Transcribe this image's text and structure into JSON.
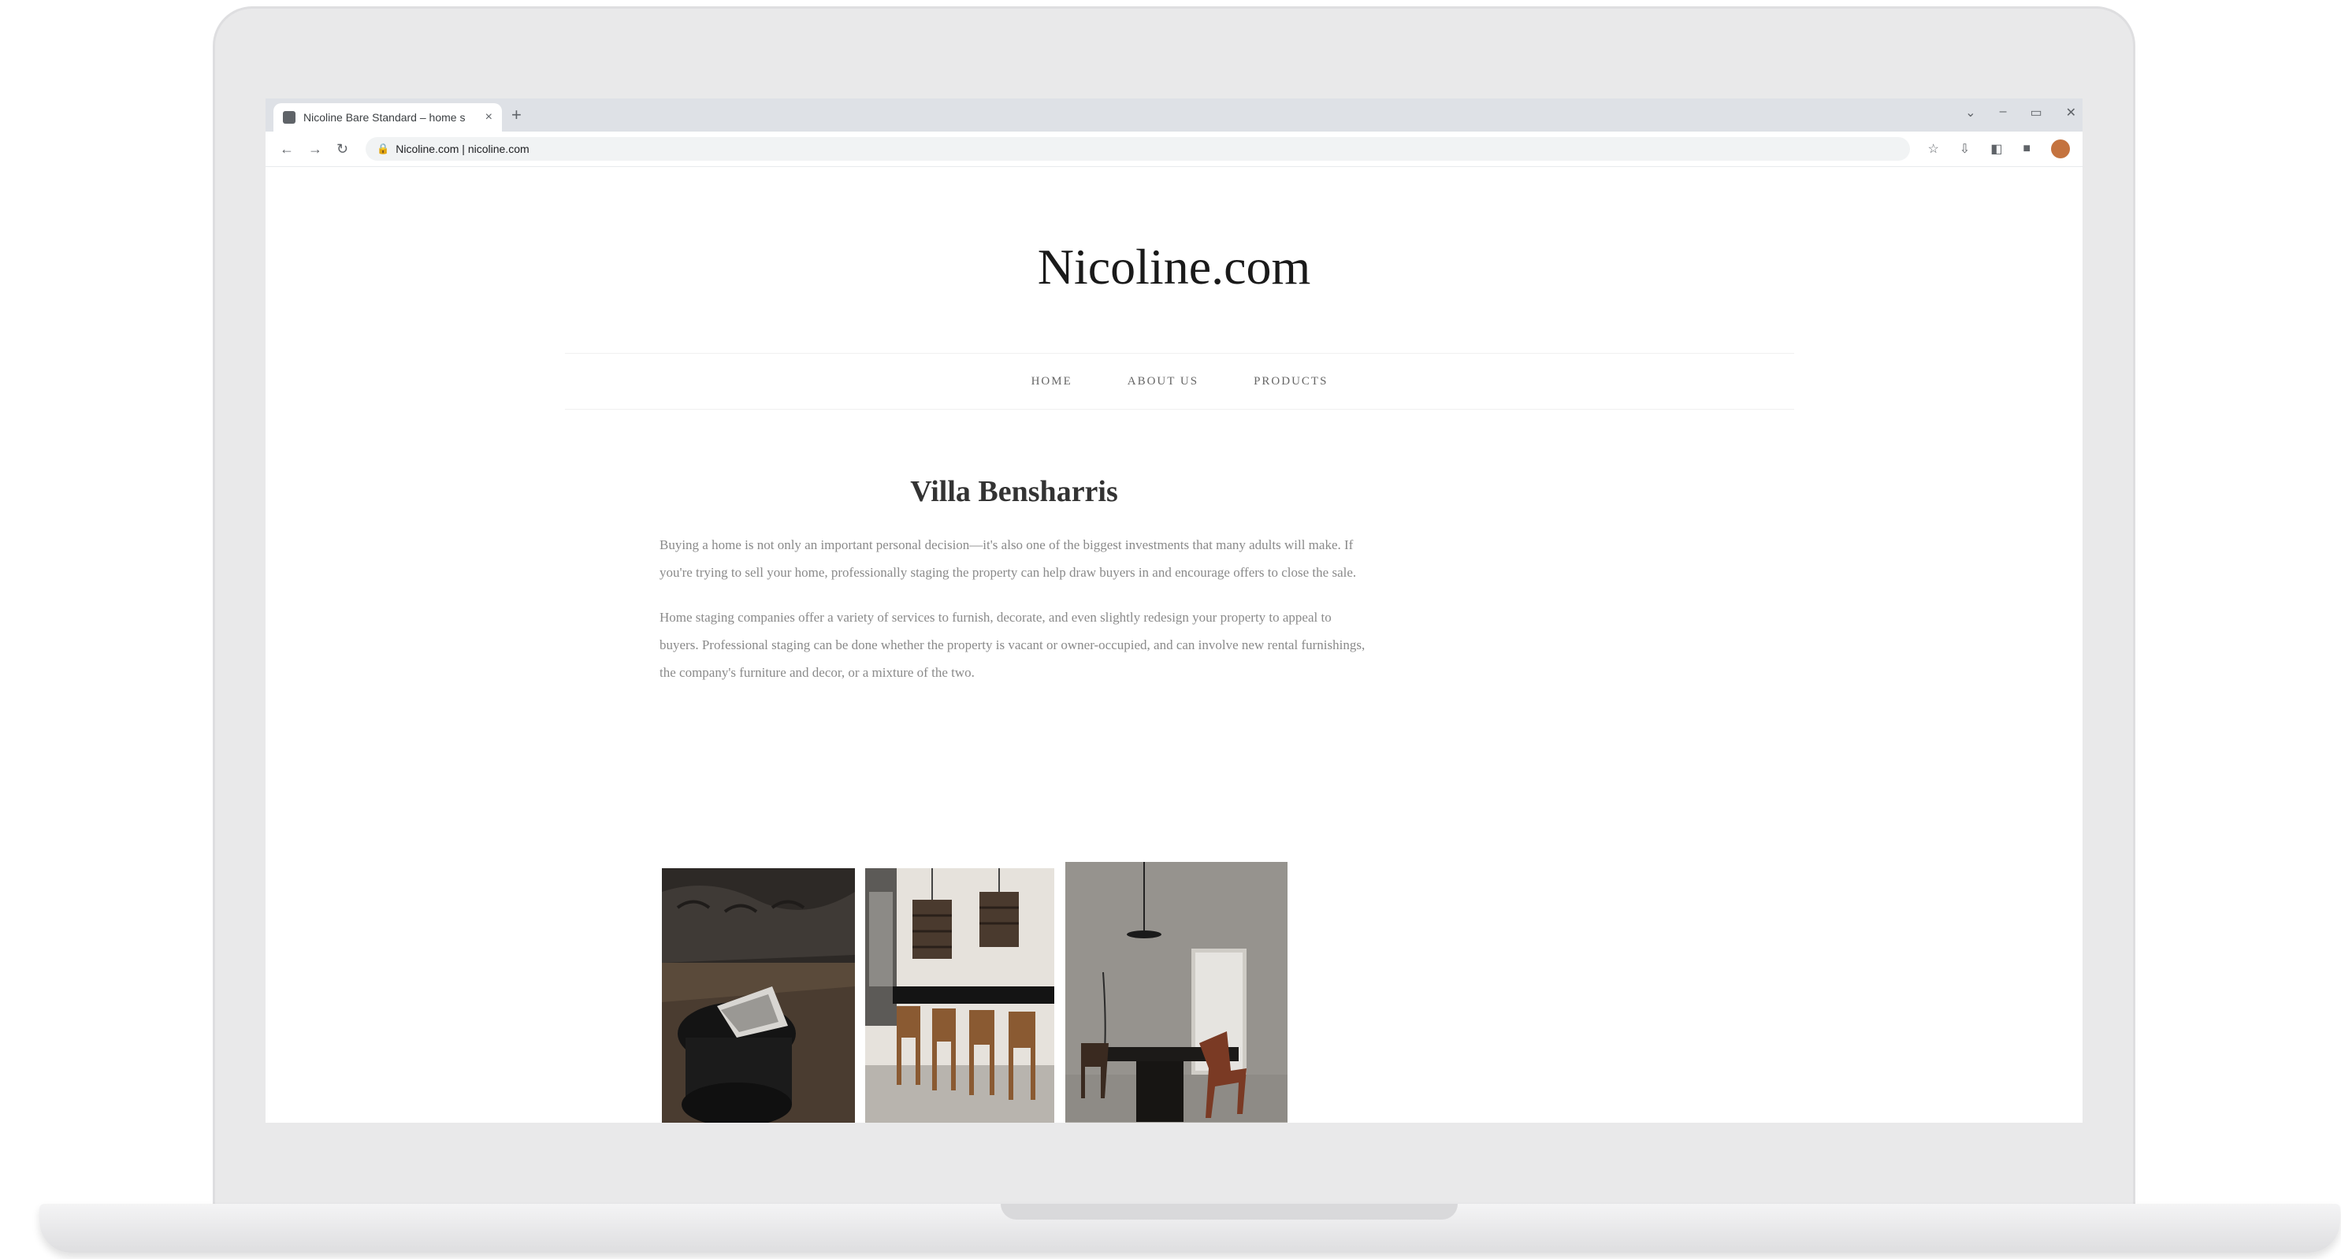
{
  "browser": {
    "tab_title": "Nicoline Bare Standard – home s",
    "tab_close": "×",
    "new_tab": "+",
    "window_controls": [
      "⌄",
      "–",
      "▭",
      "✕"
    ],
    "nav": {
      "back": "←",
      "forward": "→",
      "reload": "↻"
    },
    "lock": "🔒",
    "url": "Nicoline.com | nicoline.com",
    "toolbar_icons": [
      "☆",
      "⇩",
      "◧",
      "■"
    ]
  },
  "site": {
    "title": "Nicoline.com",
    "nav": [
      "HOME",
      "ABOUT US",
      "PRODUCTS"
    ]
  },
  "article": {
    "title": "Villa Bensharris",
    "paragraphs": [
      "Buying a home is not only an important personal decision—it's also one of the biggest investments that many adults will make. If you're trying to sell your home, professionally staging the property can help draw buyers in and encourage offers to close the sale.",
      "Home staging companies offer a variety of services to furnish, decorate, and even slightly redesign your property to appeal to buyers. Professional staging can be done whether the property is vacant or owner-occupied, and can involve new rental furnishings, the company's furniture and decor, or a mixture of the two."
    ]
  },
  "sidebar": {
    "text": ""
  },
  "gallery": [
    {
      "name": "living-room-photo"
    },
    {
      "name": "dining-room-photo"
    },
    {
      "name": "minimal-dining-photo"
    }
  ],
  "colors": {
    "laptop_frame": "#e9e9ea",
    "tabstrip": "#dee1e6",
    "site_title": "#1a1a1a"
  }
}
